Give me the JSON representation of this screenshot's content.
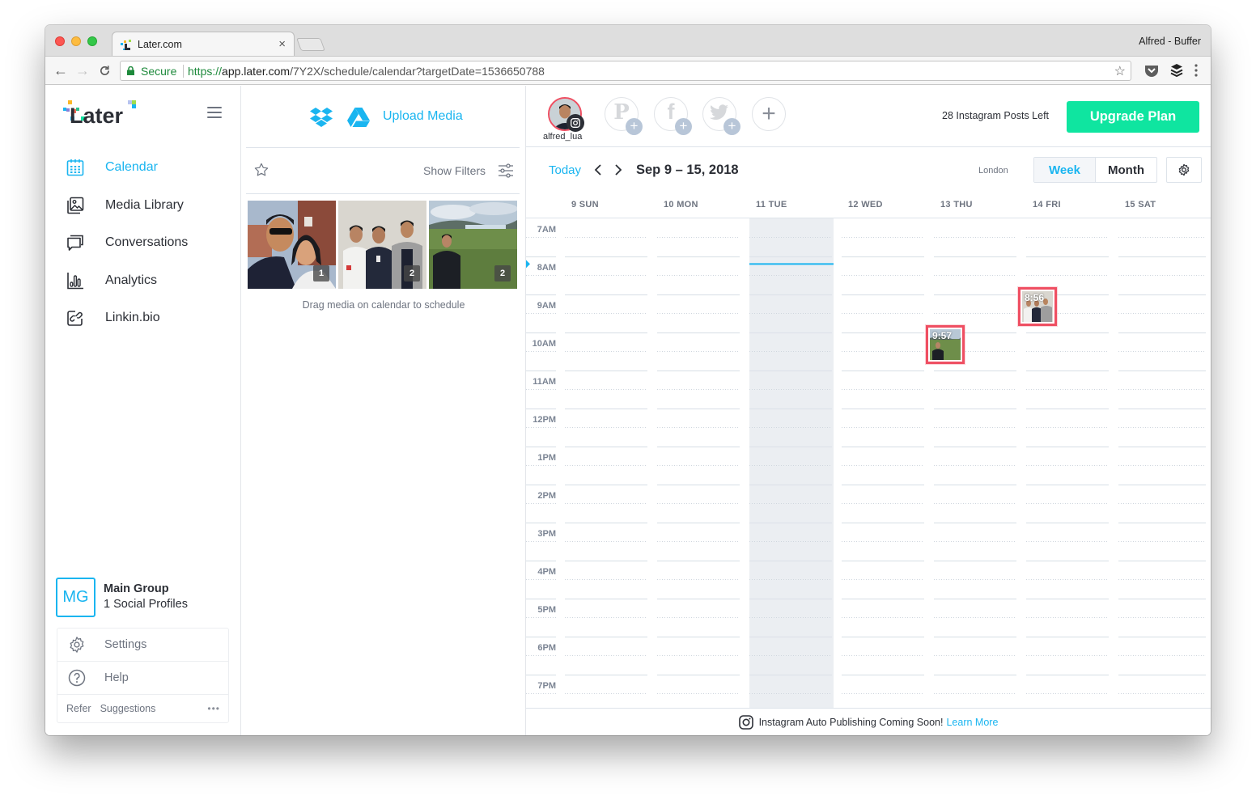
{
  "browser": {
    "tab_title": "Later.com",
    "tab_close": "×",
    "profile_name": "Alfred - Buffer",
    "secure_label": "Secure",
    "url_scheme": "https://",
    "url_host": "app.later.com",
    "url_path": "/7Y2X/schedule/calendar?targetDate=1536650788"
  },
  "sidebar": {
    "logo_text": "Later",
    "items": [
      {
        "label": "Calendar",
        "icon": "calendar-icon",
        "active": true
      },
      {
        "label": "Media Library",
        "icon": "media-library-icon",
        "active": false
      },
      {
        "label": "Conversations",
        "icon": "conversations-icon",
        "active": false
      },
      {
        "label": "Analytics",
        "icon": "analytics-icon",
        "active": false
      },
      {
        "label": "Linkin.bio",
        "icon": "linkinbio-icon",
        "active": false
      }
    ],
    "group": {
      "initials": "MG",
      "name": "Main Group",
      "profiles": "1 Social Profiles"
    },
    "menu": [
      {
        "label": "Settings",
        "icon": "gear-icon"
      },
      {
        "label": "Help",
        "icon": "help-icon"
      }
    ],
    "footer": {
      "refer": "Refer",
      "suggestions": "Suggestions",
      "more": "•••"
    }
  },
  "media": {
    "upload_label": "Upload Media",
    "show_filters": "Show Filters",
    "thumbnails": [
      {
        "count": "1",
        "subject": "selfie-couple"
      },
      {
        "count": "2",
        "subject": "three-men-office"
      },
      {
        "count": "2",
        "subject": "man-landscape"
      }
    ],
    "drag_hint": "Drag media on calendar to schedule"
  },
  "calendar": {
    "profile": {
      "username": "alfred_lua",
      "network": "instagram"
    },
    "add_profiles": [
      "pinterest",
      "facebook",
      "twitter",
      "add"
    ],
    "posts_left": "28 Instagram Posts Left",
    "upgrade_label": "Upgrade Plan",
    "today_label": "Today",
    "range": "Sep 9 – 15, 2018",
    "timezone": "London",
    "views": [
      {
        "label": "Week",
        "active": true
      },
      {
        "label": "Month",
        "active": false
      }
    ],
    "days": [
      "9 SUN",
      "10 MON",
      "11 TUE",
      "12 WED",
      "13 THU",
      "14 FRI",
      "15 SAT"
    ],
    "today_index": 2,
    "hours": [
      "7AM",
      "8AM",
      "9AM",
      "10AM",
      "11AM",
      "12PM",
      "1PM",
      "2PM",
      "3PM",
      "4PM",
      "5PM",
      "6PM",
      "7PM"
    ],
    "now_time_hours": 8.2,
    "scheduled_posts": [
      {
        "time": "9:57",
        "day_index": 4,
        "start_hour": 9.85,
        "thumb": "man-landscape"
      },
      {
        "time": "8:56",
        "day_index": 5,
        "start_hour": 8.85,
        "thumb": "three-men-office"
      }
    ],
    "banner_text": "Instagram Auto Publishing Coming Soon!",
    "banner_link": "Learn More"
  },
  "colors": {
    "accent": "#1ab5f0",
    "upgrade": "#0fe5a0",
    "post_border": "#ef4f62",
    "today_column": "#ebeef2"
  }
}
